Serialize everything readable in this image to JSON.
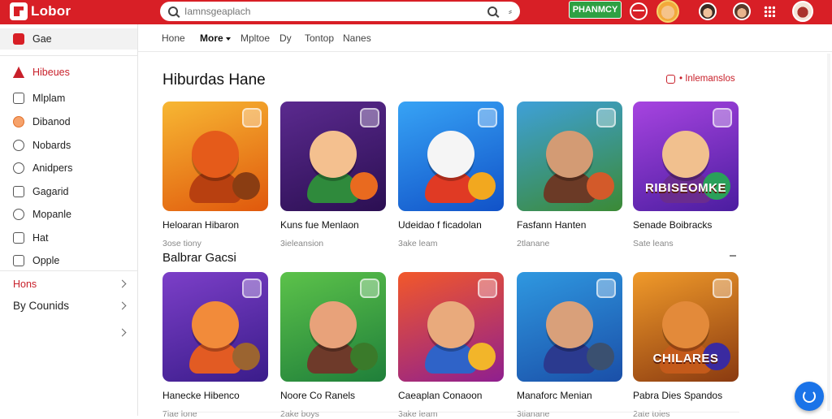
{
  "app": {
    "title": "Lobor"
  },
  "search": {
    "placeholder": "Iamnsgeaplach"
  },
  "header": {
    "promo_label": "PHANMCY"
  },
  "sidebar": {
    "items": [
      {
        "label": "Gae"
      },
      {
        "label": "Hibeues"
      },
      {
        "label": "Mlplam"
      },
      {
        "label": "Dibanod"
      },
      {
        "label": "Nobards"
      },
      {
        "label": "Anidpers"
      },
      {
        "label": "Gagarid"
      },
      {
        "label": "Mopanle"
      },
      {
        "label": "Hat"
      },
      {
        "label": "Opple"
      }
    ],
    "sections": [
      {
        "label": "Hons"
      },
      {
        "label": "By Counids"
      }
    ]
  },
  "tabs": [
    "Hone",
    "More",
    "Mpltoe",
    "Dy",
    "Tontop",
    "Nanes"
  ],
  "section1": {
    "title": "Hiburdas Hane",
    "see_more": "• Inlemanslos",
    "games": [
      {
        "name": "Heloaran Hibaron",
        "meta": "3ose tiony",
        "bg": [
          "#f7b733",
          "#e0580c"
        ],
        "hero": "#e55b1a",
        "body": "#b84010",
        "prop": "#8a3d12"
      },
      {
        "name": "Kuns fue Menlaon",
        "meta": "3ieleansion",
        "bg": [
          "#5b2a8f",
          "#2b0f52"
        ],
        "hero": "#f4c08f",
        "body": "#2f8a3c",
        "prop": "#e96a1f"
      },
      {
        "name": "Udeidao f ficadolan",
        "meta": "3ake leam",
        "bg": [
          "#37a3f5",
          "#1152c8"
        ],
        "hero": "#f5f5f5",
        "body": "#e03a24",
        "prop": "#f2a81f"
      },
      {
        "name": "Fasfann Hanten",
        "meta": "2tlanane",
        "bg": [
          "#3ea0d8",
          "#3b8a35"
        ],
        "hero": "#d39b74",
        "body": "#6b3a26",
        "prop": "#d35a2a"
      },
      {
        "name": "Senade Boibracks",
        "meta": "Sate leans",
        "bg": [
          "#a744e0",
          "#4b1da0"
        ],
        "hero": "#f1c08e",
        "body": "#6a2c8f",
        "prop": "#2aa05a",
        "banner": "RIBISEOMKE"
      }
    ]
  },
  "section2": {
    "title": "Balbrar Gacsi",
    "games": [
      {
        "name": "Hanecke Hibenco",
        "meta": "7iae lone",
        "bg": [
          "#7c3fc8",
          "#3a1c8a"
        ],
        "hero": "#f28b3a",
        "body": "#e25b23",
        "prop": "#9b6430"
      },
      {
        "name": "Noore Co Ranels",
        "meta": "2ake boys",
        "bg": [
          "#5cc24a",
          "#1f7f3a"
        ],
        "hero": "#e8a27a",
        "body": "#6e3a2a",
        "prop": "#3a7a2a"
      },
      {
        "name": "Caeaplan Conaoon",
        "meta": "3ake leam",
        "bg": [
          "#f2582a",
          "#8f1f8f"
        ],
        "hero": "#e9aa7c",
        "body": "#2f63c8",
        "prop": "#f2b52a"
      },
      {
        "name": "Manaforc Menian",
        "meta": "3tianane",
        "bg": [
          "#2f98e0",
          "#1a4fa8"
        ],
        "hero": "#d9a07a",
        "body": "#2b3a8f",
        "prop": "#3a5070"
      },
      {
        "name": "Pabra Dies Spandos",
        "meta": "2ate toies",
        "bg": [
          "#f09a2a",
          "#8a3a10"
        ],
        "hero": "#e38a3a",
        "body": "#c45a1a",
        "prop": "#3a2aa0",
        "banner": "CHILARES"
      }
    ]
  }
}
